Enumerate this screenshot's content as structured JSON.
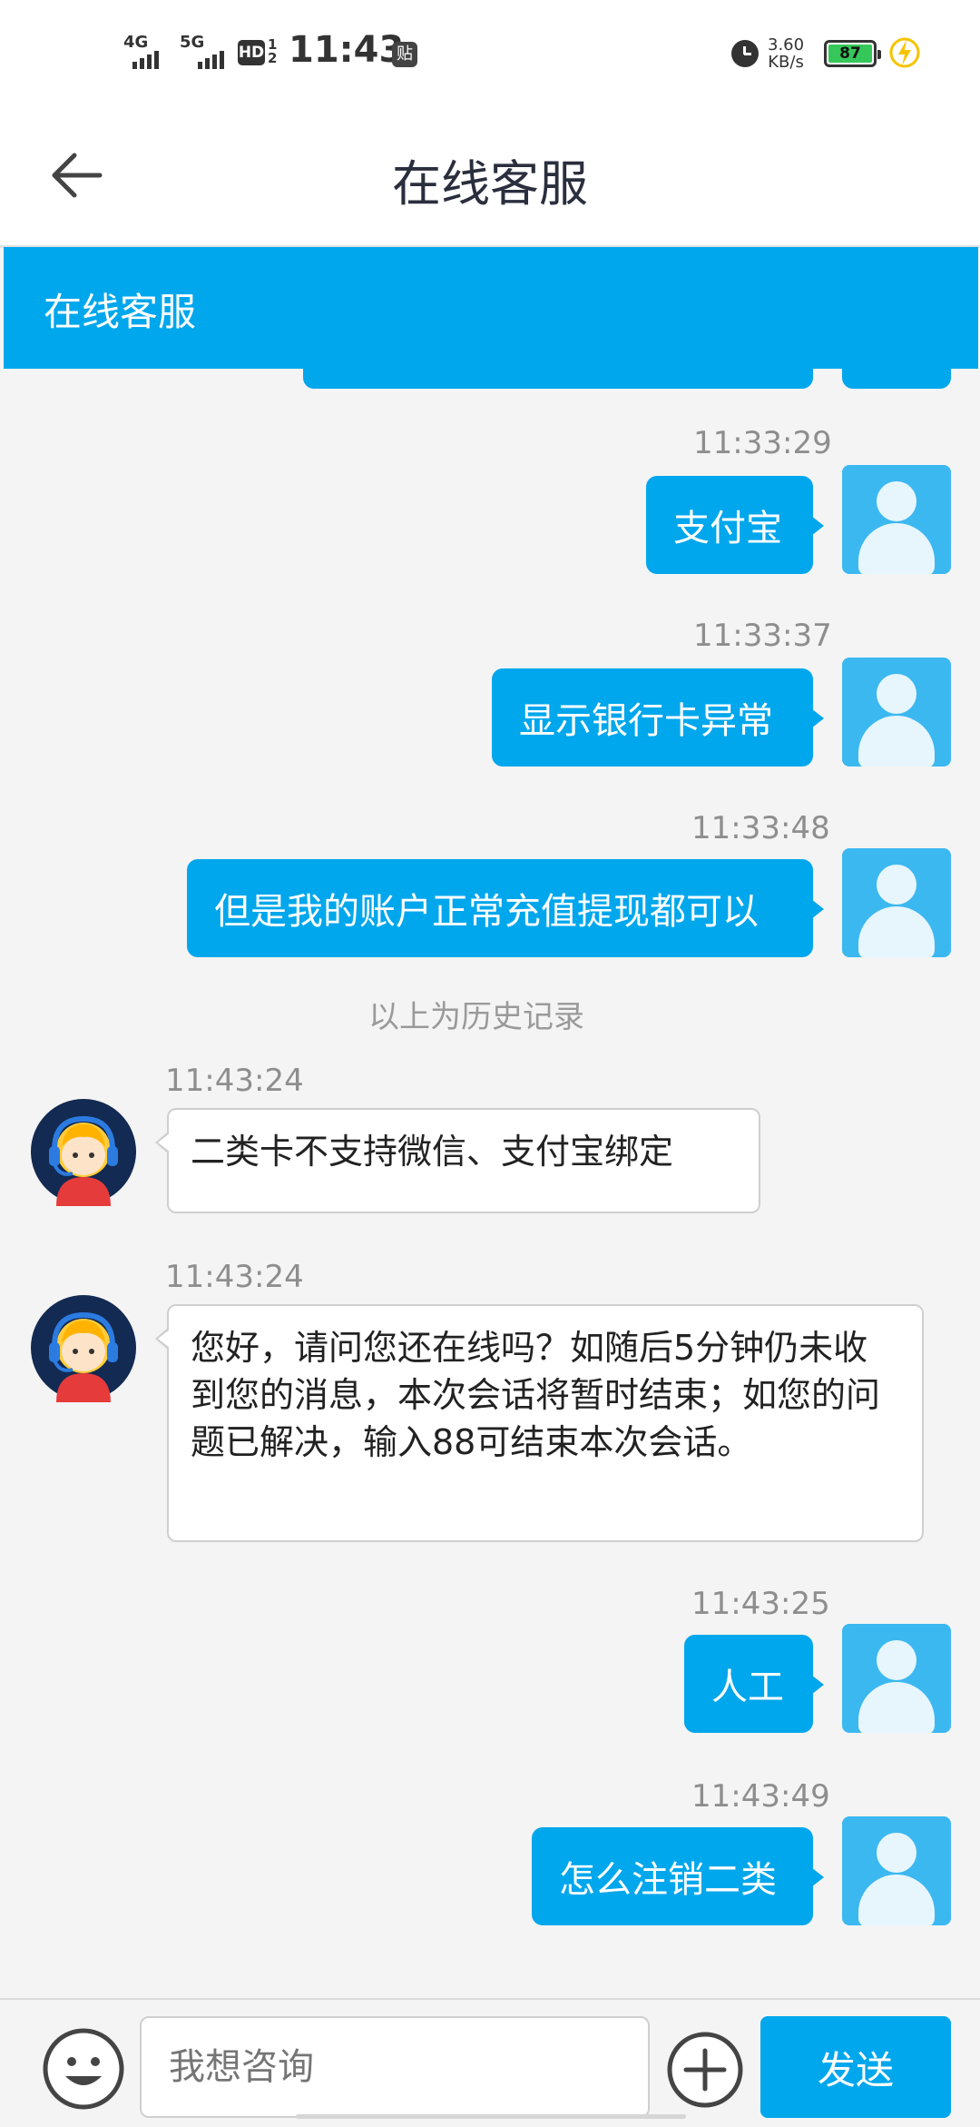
{
  "status_bar": {
    "sig1": "4G",
    "sig2": "5G",
    "hd": "HD",
    "hd_sub": "1\n2",
    "time": "11:43",
    "tie_icon": "贴",
    "speed_value": "3.60",
    "speed_unit": "KB/s",
    "battery": "87"
  },
  "header": {
    "title": "在线客服"
  },
  "banner": {
    "title": "在线客服"
  },
  "messages": [
    {
      "time": "11:33:29",
      "text": "支付宝"
    },
    {
      "time": "11:33:37",
      "text": "显示银行卡异常"
    },
    {
      "time": "11:33:48",
      "text": "但是我的账户正常充值提现都可以"
    },
    {
      "text": "以上为历史记录"
    },
    {
      "time": "11:43:24",
      "text": "二类卡不支持微信、支付宝绑定"
    },
    {
      "time": "11:43:24",
      "text": "您好，请问您还在线吗？如随后5分钟仍未收到您的消息，本次会话将暂时结束；如您的问题已解决，输入88可结束本次会话。"
    },
    {
      "time": "11:43:25",
      "text": "人工"
    },
    {
      "time": "11:43:49",
      "text": "怎么注销二类"
    }
  ],
  "input": {
    "placeholder": "我想咨询",
    "send_label": "发送"
  },
  "colors": {
    "accent": "#01a7ec",
    "background": "#f4f4f4"
  },
  "icons": {
    "back": "arrow-left-icon",
    "emoji": "smiley-icon",
    "plus": "plus-circle-icon",
    "user_avatar": "user-avatar-icon",
    "agent_avatar": "agent-headset-avatar"
  }
}
